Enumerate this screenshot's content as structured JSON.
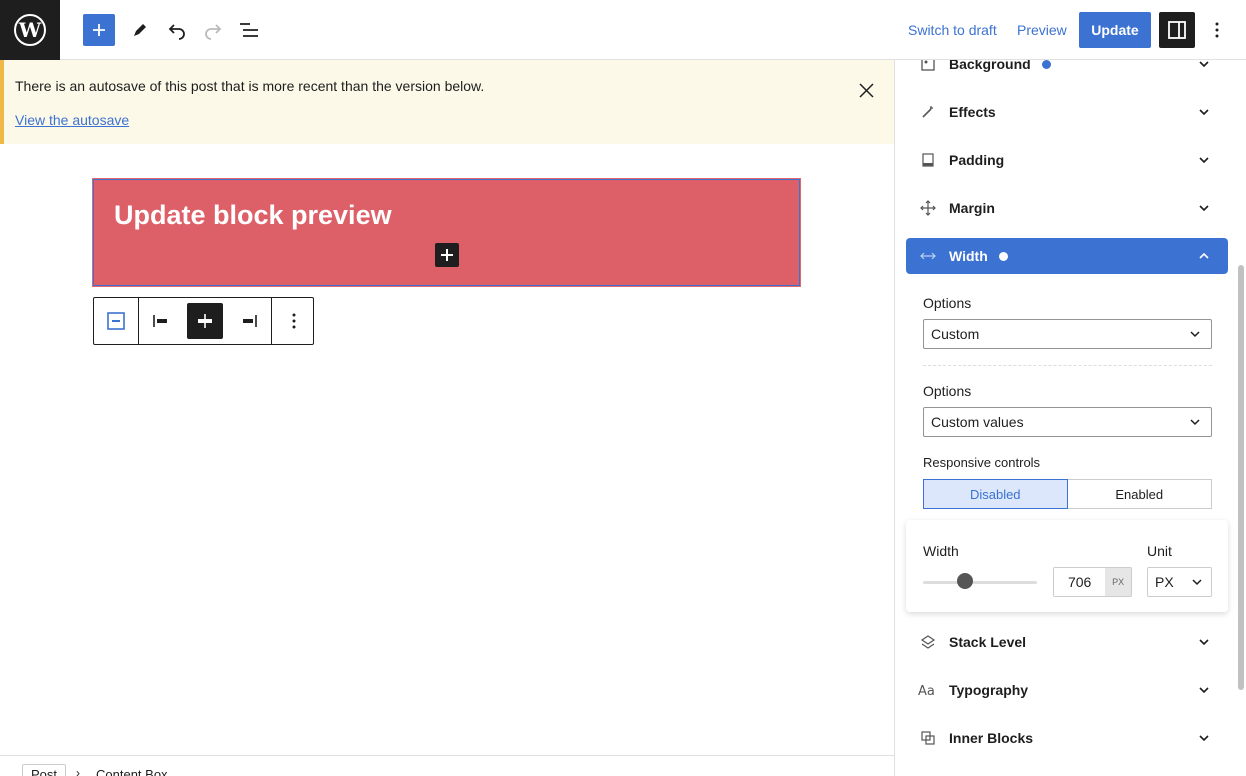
{
  "topbar": {
    "logo_letter": "W",
    "switch_draft": "Switch to draft",
    "preview": "Preview",
    "update": "Update"
  },
  "notice": {
    "text": "There is an autosave of this post that is more recent than the version below.",
    "link": "View the autosave"
  },
  "block": {
    "title": "Update block preview",
    "color": "#dd5f67"
  },
  "breadcrumb": {
    "root": "Post",
    "current": "Content Box"
  },
  "sidebar": {
    "panels": {
      "background": "Background",
      "effects": "Effects",
      "padding": "Padding",
      "margin": "Margin",
      "width": "Width",
      "stack_level": "Stack Level",
      "typography": "Typography",
      "inner_blocks": "Inner Blocks"
    },
    "width_panel": {
      "options_label_1": "Options",
      "options_value_1": "Custom",
      "options_label_2": "Options",
      "options_value_2": "Custom values",
      "responsive_label": "Responsive controls",
      "responsive_disabled": "Disabled",
      "responsive_enabled": "Enabled",
      "width_label": "Width",
      "width_value": "706",
      "width_unit_suffix": "PX",
      "unit_label": "Unit",
      "unit_value": "PX"
    }
  },
  "colors": {
    "accent": "#3c72d1",
    "dark": "#1e1e1e",
    "notice_bg": "#fcf9e8",
    "notice_border": "#f0b849"
  }
}
